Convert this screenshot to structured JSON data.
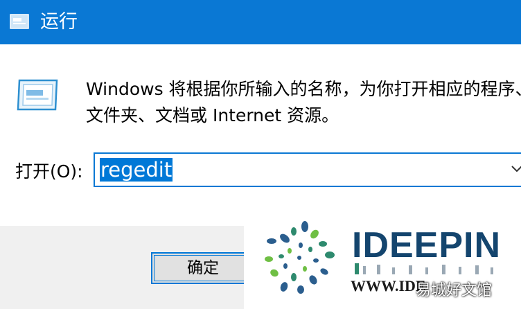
{
  "window": {
    "title": "运行",
    "accent_color": "#0a78d4",
    "title_icon": "run-dialog-icon"
  },
  "content": {
    "icon": "run-program-icon",
    "description_line1": "Windows 将根据你所输入的名称，为你打开相应的程序、",
    "description_line2": "文件夹、文档或 Internet 资源。"
  },
  "open_field": {
    "label": "打开(O):",
    "value": "regedit",
    "dropdown_icon": "chevron-down-icon"
  },
  "buttons": {
    "ok_label": "确定"
  },
  "watermark": {
    "brand": "IDEEPIN",
    "url": "WWW.IDE",
    "caption": "易城好文馆"
  }
}
